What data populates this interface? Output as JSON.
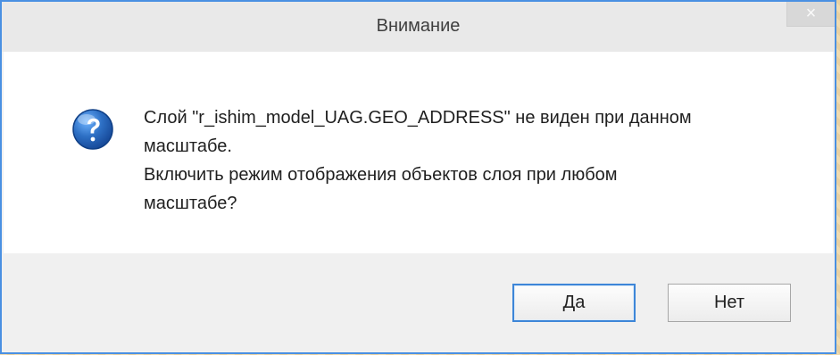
{
  "dialog": {
    "title": "Внимание",
    "close_glyph": "×",
    "message": "Слой \"r_ishim_model_UAG.GEO_ADDRESS\" не виден при данном\nмасштабе.\nВключить режим отображения объектов слоя при любом\nмасштабе?",
    "icon_name": "question-icon",
    "buttons": {
      "yes": "Да",
      "no": "Нет"
    }
  },
  "colors": {
    "accent_border": "#4a90e2",
    "background_pattern": "#efd7a6",
    "icon_blue": "#2d6fc4"
  }
}
